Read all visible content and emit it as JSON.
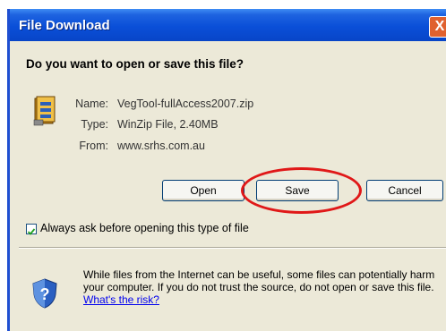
{
  "window": {
    "title": "File Download",
    "close_label": "X"
  },
  "dialog": {
    "question": "Do you want to open or save this file?",
    "file_info": {
      "name_label": "Name:",
      "name_value": "VegTool-fullAccess2007.zip",
      "type_label": "Type:",
      "type_value": "WinZip File, 2.40MB",
      "from_label": "From:",
      "from_value": "www.srhs.com.au"
    },
    "buttons": {
      "open": "Open",
      "save": "Save",
      "cancel": "Cancel"
    },
    "always_ask": {
      "label": "Always ask before opening this type of file",
      "checked": true
    },
    "warning": {
      "text": "While files from the Internet can be useful, some files can potentially harm your computer. If you do not trust the source, do not open or save this file.",
      "link": "What's the risk?"
    }
  },
  "colors": {
    "titlebar": "#0a4fd8",
    "highlight": "#e01818"
  }
}
